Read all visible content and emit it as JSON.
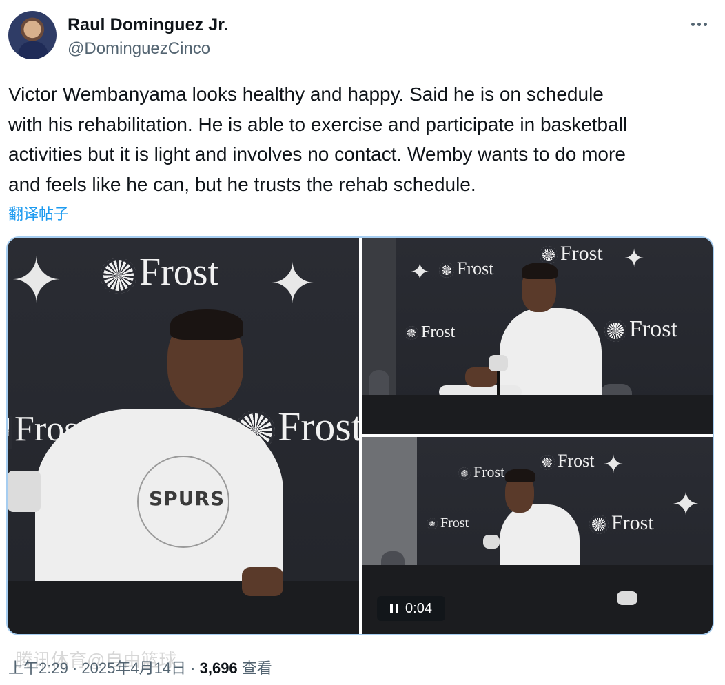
{
  "author": {
    "display_name": "Raul Dominguez Jr.",
    "handle": "@DominguezCinco",
    "avatar_icon": "user-avatar"
  },
  "more_icon": "more-horizontal-icon",
  "tweet": {
    "text": "Victor Wembanyama looks healthy and happy. Said he is on schedule\nwith his rehabilitation. He is able to exercise and participate in basketball\nactivities but it is light and involves no contact. Wemby wants to do more\nand feels like he can, but he trusts the rehab schedule.",
    "translate_label": "翻译帖子"
  },
  "media": {
    "sponsor_text": "Frost",
    "shirt_text": "SPURS",
    "video": {
      "icon": "pause-icon",
      "time": "0:04"
    }
  },
  "meta": {
    "time": "上午2:29",
    "separator1": " · ",
    "date": "2025年4月14日",
    "separator2": " · ",
    "views_count": "3,696",
    "views_label": " 查看"
  },
  "watermark": "腾讯体育@自由篮球",
  "colors": {
    "accent": "#1d9bf0",
    "text": "#0f1419",
    "secondary": "#536471",
    "media_border": "#a6cdf0"
  }
}
